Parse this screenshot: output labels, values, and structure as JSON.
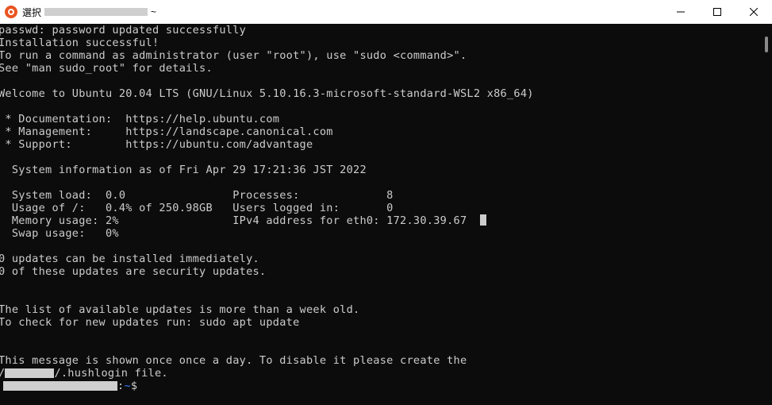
{
  "window": {
    "title_prefix": "選択",
    "title_suffix": "~",
    "controls": [
      "minimize",
      "maximize",
      "close"
    ]
  },
  "terminal": {
    "lines": [
      "passwd: password updated successfully",
      "Installation successful!",
      "To run a command as administrator (user \"root\"), use \"sudo <command>\".",
      "See \"man sudo_root\" for details.",
      "",
      "Welcome to Ubuntu 20.04 LTS (GNU/Linux 5.10.16.3-microsoft-standard-WSL2 x86_64)",
      "",
      " * Documentation:  https://help.ubuntu.com",
      " * Management:     https://landscape.canonical.com",
      " * Support:        https://ubuntu.com/advantage",
      "",
      "  System information as of Fri Apr 29 17:21:36 JST 2022",
      "",
      "  System load:  0.0                Processes:             8",
      "  Usage of /:   0.4% of 250.98GB   Users logged in:       0",
      "  Memory usage: 2%                 IPv4 address for eth0: 172.30.39.67",
      "  Swap usage:   0%",
      "",
      "0 updates can be installed immediately.",
      "0 of these updates are security updates.",
      "",
      "",
      "The list of available updates is more than a week old.",
      "To check for new updates run: sudo apt update",
      "",
      "",
      "This message is shown once once a day. To disable it please create the",
      "/",
      ""
    ],
    "hushlogin_tail": "/.hushlogin file.",
    "prompt_sep": ":",
    "prompt_path": "~",
    "prompt_symbol": "$"
  }
}
